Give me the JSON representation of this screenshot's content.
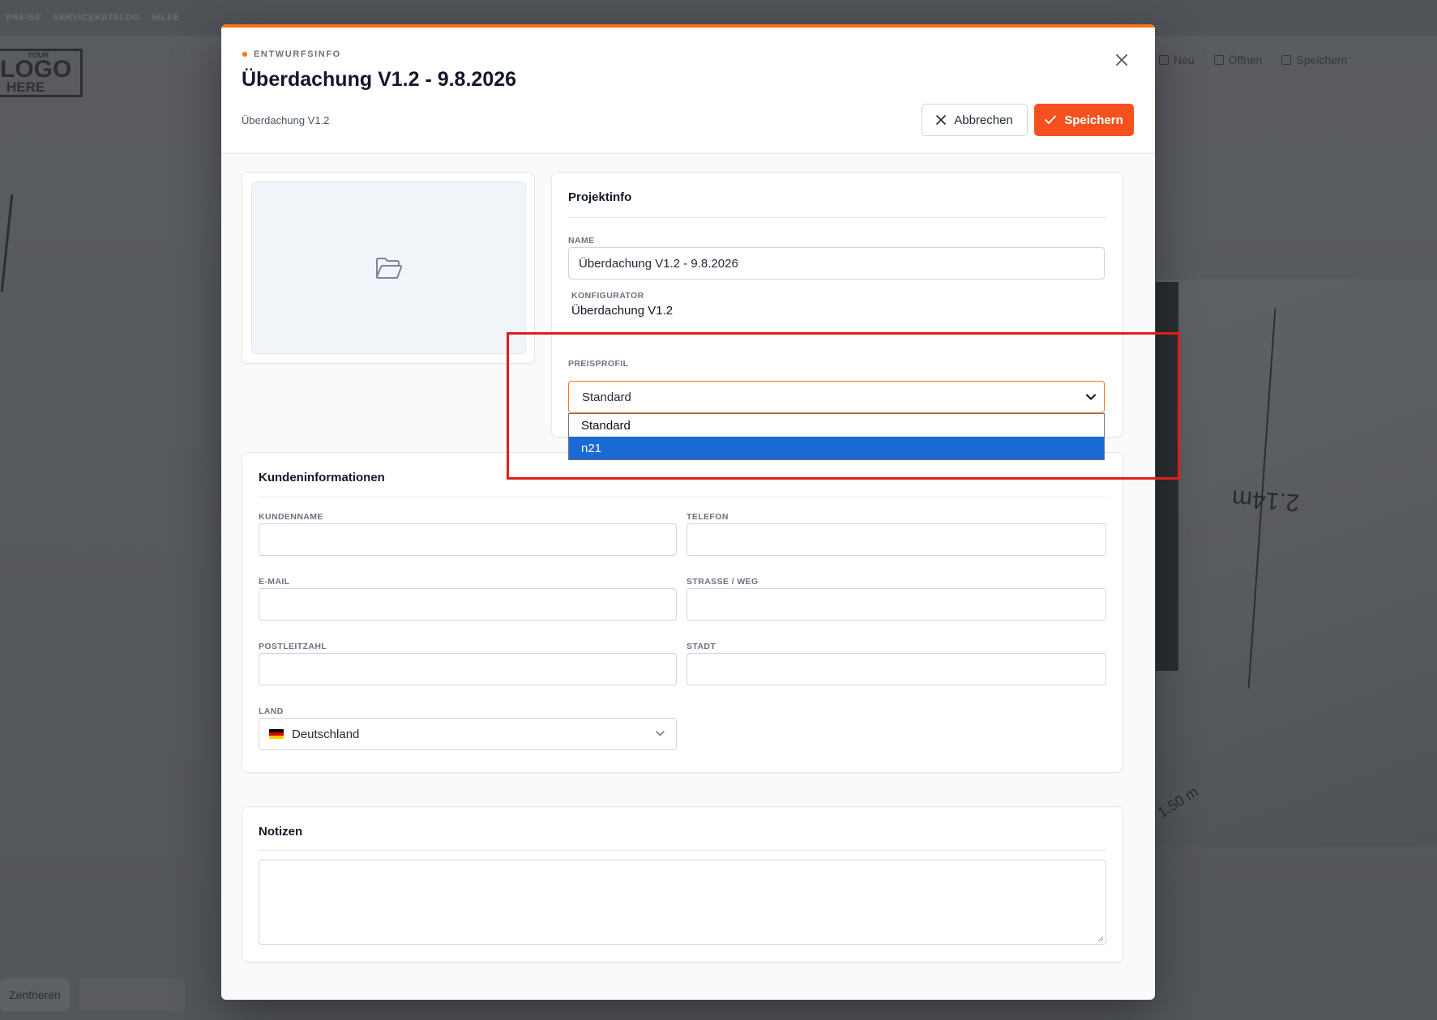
{
  "background": {
    "topnav": [
      "PREISE",
      "SERVICEKATALOG",
      "HILFE"
    ],
    "logo": {
      "line1": "YOUR",
      "line2": "LOGO",
      "line3": "HERE"
    },
    "toolbar": [
      "Neu",
      "Öffnen",
      "Speichern"
    ],
    "dim_label": "2.14m",
    "dim_label2": "1.50 m",
    "bottom_left_button": "Zentrieren"
  },
  "modal": {
    "eyebrow": "ENTWURFSINFO",
    "title": "Überdachung V1.2 - 9.8.2026",
    "subtitle": "Überdachung V1.2",
    "cancel_label": "Abbrechen",
    "save_label": "Speichern"
  },
  "project": {
    "title": "Projektinfo",
    "name_label": "NAME",
    "name_value": "Überdachung V1.2 - 9.8.2026",
    "configurator_label": "KONFIGURATOR",
    "configurator_value": "Überdachung V1.2",
    "price_profile_label": "PREISPROFIL",
    "price_profile_selected": "Standard",
    "price_profile_options": [
      "Standard",
      "n21"
    ],
    "price_profile_highlighted": "n21"
  },
  "customer": {
    "title": "Kundeninformationen",
    "name_label": "KUNDENNAME",
    "name_value": "",
    "phone_label": "TELEFON",
    "phone_value": "",
    "email_label": "E-MAIL",
    "email_value": "",
    "street_label": "STRASSE / WEG",
    "street_value": "",
    "zip_label": "POSTLEITZAHL",
    "zip_value": "",
    "city_label": "STADT",
    "city_value": "",
    "country_label": "LAND",
    "country_value": "Deutschland",
    "flag_colors": [
      "#000000",
      "#dd0000",
      "#ffce00"
    ]
  },
  "notes": {
    "title": "Notizen",
    "value": ""
  },
  "colors": {
    "accent": "#f97316",
    "save_button": "#f4511e",
    "selection_blue": "#1a6ad6",
    "highlight": "#e11d1d"
  }
}
